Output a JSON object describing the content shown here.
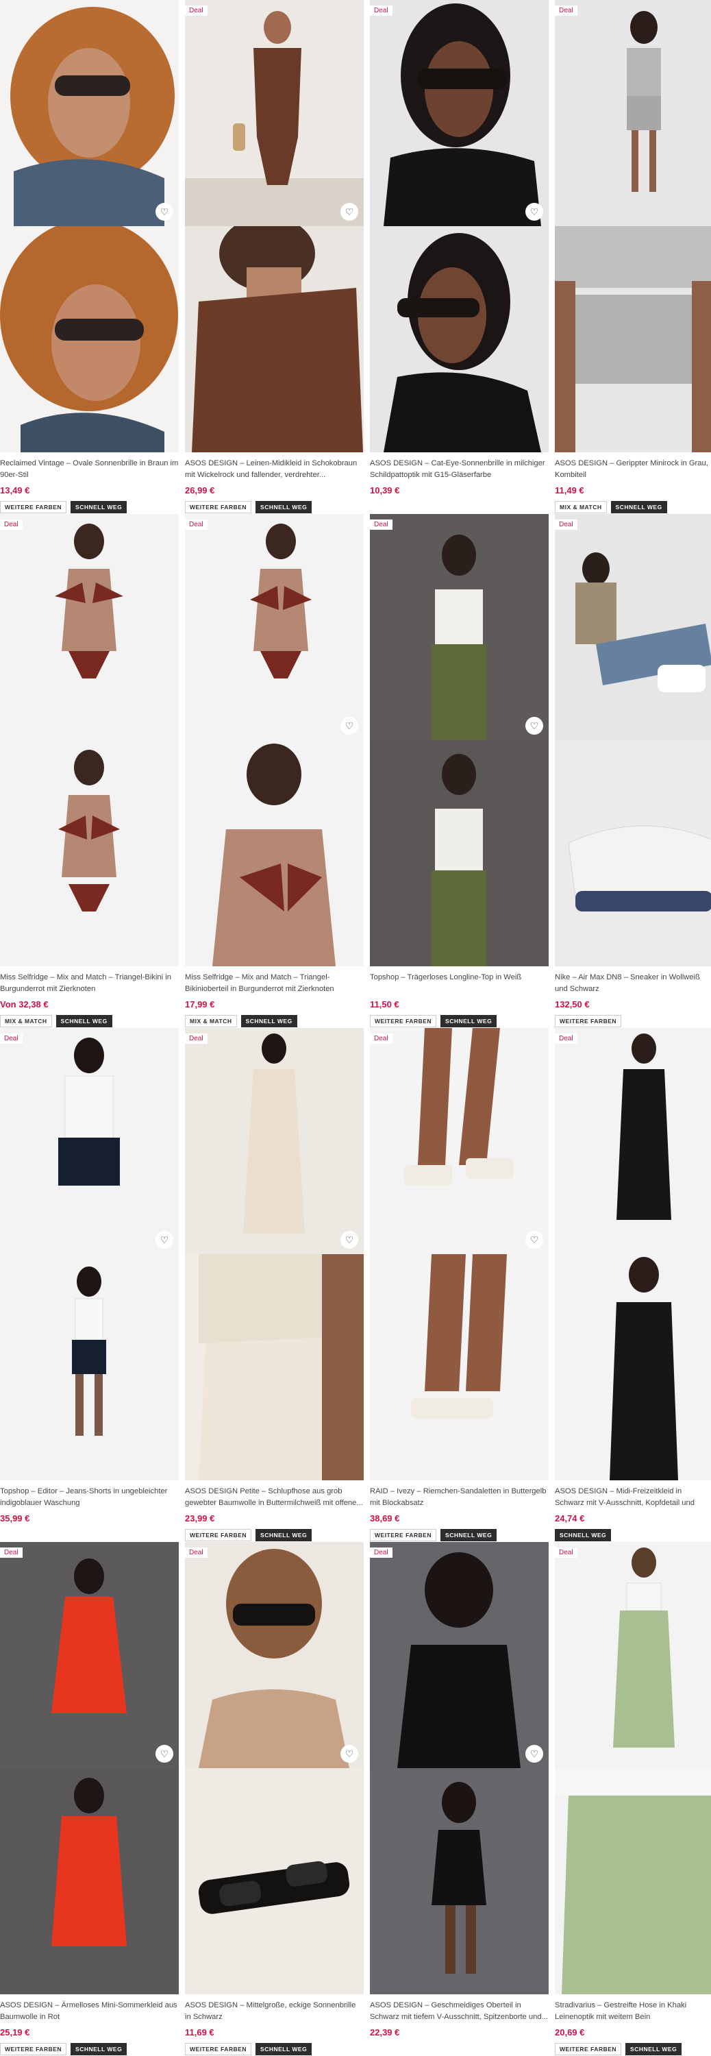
{
  "badges": {
    "deal": "Deal"
  },
  "tags": {
    "weitere": "WEITERE FARBEN",
    "schnell": "SCHNELL WEG",
    "mix": "MIX & MATCH"
  },
  "products": [
    {
      "title": "Reclaimed Vintage – Ovale Sonnenbrille in Braun im 90er-Stil",
      "price": "13,49 €"
    },
    {
      "title": "ASOS DESIGN – Leinen-Midikleid in Schokobraun mit Wickelrock und fallender, verdrehter...",
      "price": "26,99 €"
    },
    {
      "title": "ASOS DESIGN – Cat-Eye-Sonnenbrille in milchiger Schildpattoptik mit G15-Gläserfarbe",
      "price": "10,39 €"
    },
    {
      "title": "ASOS DESIGN – Gerippter Minirock in Grau, Kombiteil",
      "price": "11,49 €"
    },
    {
      "title": "Miss Selfridge – Mix and Match – Triangel-Bikini in Burgunderrot mit Zierknoten",
      "price": "Von 32,38 €"
    },
    {
      "title": "Miss Selfridge – Mix and Match – Triangel-Bikinioberteil in Burgunderrot mit Zierknoten",
      "price": "17,99 €"
    },
    {
      "title": "Topshop – Trägerloses Longline-Top in Weiß",
      "price": "11,50 €"
    },
    {
      "title": "Nike – Air Max DN8 – Sneaker in Wollweiß und Schwarz",
      "price": "132,50 €"
    },
    {
      "title": "Topshop – Editor – Jeans-Shorts in ungebleichter indigoblauer Waschung",
      "price": "35,99 €"
    },
    {
      "title": "ASOS DESIGN Petite – Schlupfhose aus grob gewebter Baumwolle in Buttermilchweiß mit offene...",
      "price": "23,99 €"
    },
    {
      "title": "RAID – Ivezy – Riemchen-Sandaletten in Buttergelb mit Blockabsatz",
      "price": "38,69 €"
    },
    {
      "title": "ASOS DESIGN – Midi-Freizeitkleid in Schwarz mit V-Ausschnitt, Kopfdetail und geraffter Vorderpartie",
      "price": "24,74 €"
    },
    {
      "title": "ASOS DESIGN – Ärmelloses Mini-Sommerkleid aus Baumwolle in Rot",
      "price": "25,19 €"
    },
    {
      "title": "ASOS DESIGN – Mittelgroße, eckige Sonnenbrille in Schwarz",
      "price": "11,69 €"
    },
    {
      "title": "ASOS DESIGN – Geschmeidiges Oberteil in Schwarz mit tiefem V-Ausschnitt, Spitzenborte und...",
      "price": "22,39 €"
    },
    {
      "title": "Stradivarius – Gestreifte Hose in Khaki Leinenoptik mit weitem Bein",
      "price": "20,69 €"
    }
  ]
}
